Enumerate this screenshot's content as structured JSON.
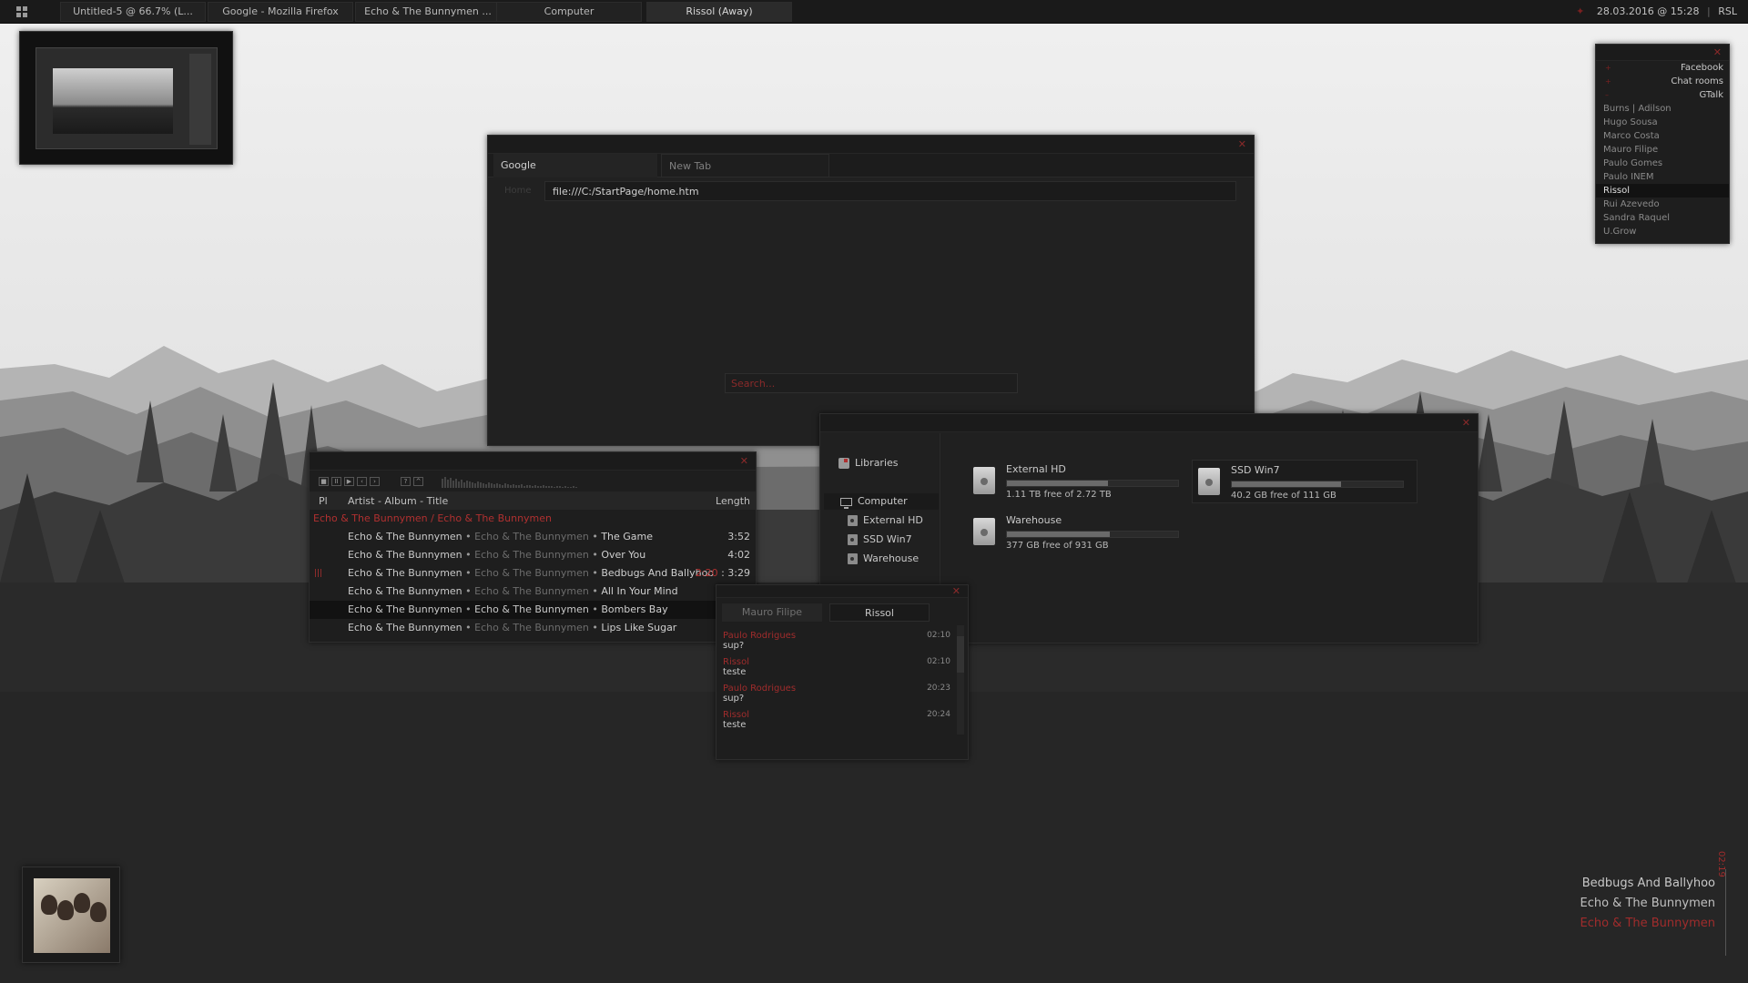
{
  "taskbar": {
    "tabs": [
      {
        "label": "Untitled-5 @ 66.7% (L..."
      },
      {
        "label": "Google - Mozilla Firefox"
      },
      {
        "label": "Echo & The Bunnymen ..."
      },
      {
        "label": "Computer"
      },
      {
        "label": "Rissol (Away)"
      }
    ],
    "clock": "28.03.2016 @ 15:28",
    "lang": "RSL"
  },
  "browser": {
    "tabs": [
      {
        "label": "Google"
      },
      {
        "label": "New Tab"
      }
    ],
    "url_label": "Home",
    "url": "file:///C:/StartPage/home.htm",
    "search_placeholder": "Search..."
  },
  "player": {
    "col_pl": "Pl",
    "col_title": "Artist - Album - Title",
    "col_length": "Length",
    "group": "Echo & The Bunnymen / Echo & The Bunnymen",
    "separator": "•",
    "tracks": [
      {
        "artist": "Echo & The Bunnymen",
        "album": "Echo & The Bunnymen",
        "title": "The Game",
        "length": "3:52"
      },
      {
        "artist": "Echo & The Bunnymen",
        "album": "Echo & The Bunnymen",
        "title": "Over You",
        "length": "4:02"
      },
      {
        "artist": "Echo & The Bunnymen",
        "album": "Echo & The Bunnymen",
        "title": "Bedbugs And Ballyhoo",
        "elapsed": "2:20",
        "length": "3:29",
        "indicator": "|||"
      },
      {
        "artist": "Echo & The Bunnymen",
        "album": "Echo & The Bunnymen",
        "title": "All In Your Mind",
        "length": ""
      },
      {
        "artist": "Echo & The Bunnymen",
        "album": "Echo & The Bunnymen",
        "title": "Bombers Bay",
        "length": ""
      },
      {
        "artist": "Echo & The Bunnymen",
        "album": "Echo & The Bunnymen",
        "title": "Lips Like Sugar",
        "length": ""
      }
    ]
  },
  "files": {
    "sidebar": {
      "libraries": "Libraries",
      "computer": "Computer",
      "drives": [
        "External HD",
        "SSD Win7",
        "Warehouse"
      ]
    },
    "drives": [
      {
        "name": "External HD",
        "free": "1.11 TB free of 2.72 TB",
        "used_fraction": 0.59
      },
      {
        "name": "SSD Win7",
        "free": "40.2 GB free of 111 GB",
        "used_fraction": 0.64
      },
      {
        "name": "Warehouse",
        "free": "377 GB free of 931 GB",
        "used_fraction": 0.6
      }
    ]
  },
  "chat": {
    "tabs": [
      {
        "label": "Mauro Filipe"
      },
      {
        "label": "Rissol"
      }
    ],
    "messages": [
      {
        "from": "Paulo Rodrigues",
        "time": "02:10",
        "text": "sup?"
      },
      {
        "from": "Rissol",
        "time": "02:10",
        "text": "teste"
      },
      {
        "from": "Paulo Rodrigues",
        "time": "20:23",
        "text": "sup?"
      },
      {
        "from": "Rissol",
        "time": "20:24",
        "text": "teste"
      }
    ]
  },
  "contacts": {
    "groups": [
      "Facebook",
      "Chat rooms",
      "GTalk"
    ],
    "list": [
      "Burns | Adilson",
      "Hugo Sousa",
      "Marco Costa",
      "Mauro Filipe",
      "Paulo Gomes",
      "Paulo INEM",
      "Rissol",
      "Rui Azevedo",
      "Sandra Raquel",
      "U.Grow"
    ],
    "selected": "Rissol"
  },
  "nowplaying": {
    "title": "Bedbugs And Ballyhoo",
    "artist": "Echo & The Bunnymen",
    "album": "Echo & The Bunnymen",
    "time": "02:19"
  },
  "colors": {
    "accent": "#b03030",
    "background": "#3a3a3a",
    "panel": "#1f1f1f"
  },
  "icons": {
    "start": "grid-icon",
    "close": "close-icon",
    "library": "library-icon",
    "computer": "monitor-icon",
    "drive": "drive-icon"
  }
}
